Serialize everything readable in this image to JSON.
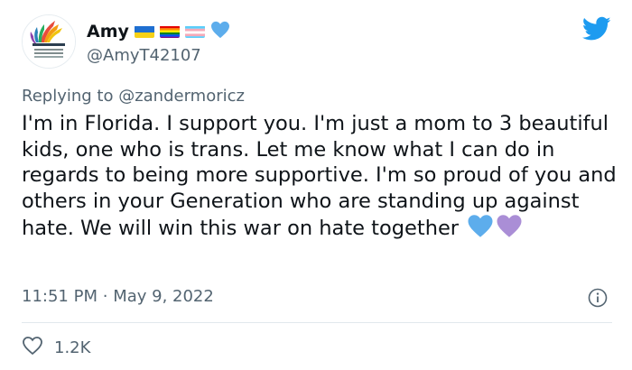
{
  "colors": {
    "twitter_blue": "#1d9bf0",
    "muted_text": "#536471",
    "body_text": "#0f1419",
    "blue_heart": "#5dadec",
    "purple_heart": "#aa8ed6"
  },
  "user": {
    "display_name": "Amy",
    "handle": "@AmyT42107",
    "flags": [
      "ukraine-flag",
      "rainbow-pride-flag",
      "transgender-flag",
      "blue-heart"
    ]
  },
  "reply": {
    "prefix": "Replying to ",
    "mention": "@zandermoricz"
  },
  "tweet": {
    "text": "I'm in Florida. I support you. I'm just a mom to 3 beautiful kids, one who is trans. Let me know what I can do in regards to being more supportive. I'm so proud of you and others in your Generation who are standing up against hate. We will win this war on hate together",
    "emojis": [
      "blue-heart",
      "purple-heart"
    ],
    "time": "11:51 PM",
    "separator": "·",
    "date": "May 9, 2022"
  },
  "stats": {
    "likes": "1.2K"
  },
  "icons": {
    "brand": "twitter-bird-icon",
    "info": "info-icon",
    "like": "heart-icon"
  }
}
